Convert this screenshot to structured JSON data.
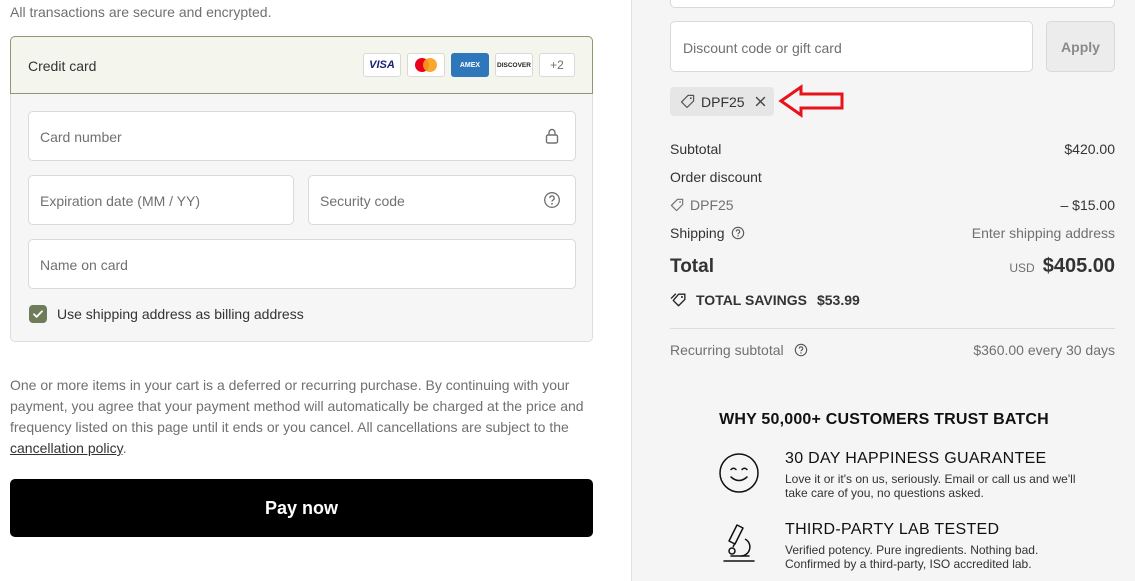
{
  "left": {
    "secure_note": "All transactions are secure and encrypted.",
    "payment_method_label": "Credit card",
    "card_logos": {
      "visa": "VISA",
      "amex": "AMEX",
      "discover": "DISCOVER",
      "more": "+2"
    },
    "fields": {
      "card_number": "Card number",
      "expiration": "Expiration date (MM / YY)",
      "security_code": "Security code",
      "name_on_card": "Name on card"
    },
    "billing_checkbox": {
      "label": "Use shipping address as billing address",
      "checked": true
    },
    "disclaimer": "One or more items in your cart is a deferred or recurring purchase. By continuing with your payment, you agree that your payment method will automatically be charged at the price and frequency listed on this page until it ends or you cancel. All cancellations are subject to the",
    "disclaimer_link": "cancellation policy",
    "disclaimer_end": ".",
    "pay_button": "Pay now"
  },
  "right": {
    "discount_placeholder": "Discount code or gift card",
    "apply_button": "Apply",
    "applied_code": "DPF25",
    "subtotal_label": "Subtotal",
    "subtotal_value": "$420.00",
    "order_discount_label": "Order discount",
    "discount_code": "DPF25",
    "discount_value": "– $15.00",
    "shipping_label": "Shipping",
    "shipping_value": "Enter shipping address",
    "total_label": "Total",
    "total_currency": "USD",
    "total_value": "$405.00",
    "savings_label": "TOTAL SAVINGS",
    "savings_value": "$53.99",
    "recurring_label": "Recurring subtotal",
    "recurring_value": "$360.00 every 30 days",
    "trust_title": "WHY 50,000+ CUSTOMERS TRUST BATCH",
    "trust_items": [
      {
        "icon": "smiley-icon",
        "heading": "30 DAY HAPPINESS GUARANTEE",
        "body": "Love it or it's on us, seriously. Email or call us and we'll take care of you, no questions asked."
      },
      {
        "icon": "microscope-icon",
        "heading": "THIRD-PARTY LAB TESTED",
        "body": "Verified potency. Pure ingredients. Nothing bad. Confirmed by a third-party, ISO accredited lab."
      }
    ]
  },
  "colors": {
    "accent_green": "#6f7b59",
    "selected_border": "#8a9a73",
    "pay_button_bg": "#000000",
    "annotation_arrow": "#e8121b"
  }
}
